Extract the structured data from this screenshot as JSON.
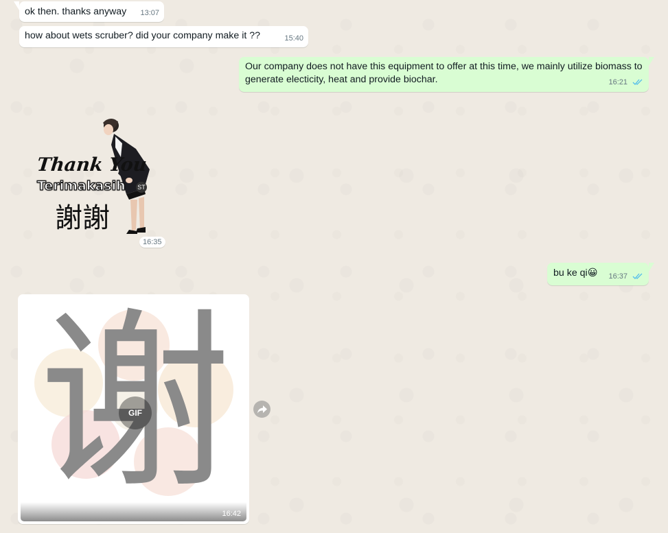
{
  "messages": [
    {
      "text": "ok then. thanks anyway",
      "time": "13:07"
    },
    {
      "text": "how about wets scruber? did your company make it ??",
      "time": "15:40"
    },
    {
      "text": "Our company does not have this equipment to offer at this time, we mainly utilize biomass to generate electicity, heat and provide biochar.",
      "time": "16:21"
    },
    {
      "text": "bu ke qi",
      "emoji": "😀",
      "time": "16:37"
    }
  ],
  "sticker": {
    "line1": "Thank You",
    "line2": "Terimakasih",
    "line3": "謝謝",
    "watermark": "ST",
    "time": "16:35"
  },
  "gif": {
    "character": "谢",
    "badge": "GIF",
    "time": "16:42"
  },
  "icons": {
    "read_receipt": "double-check-icon",
    "forward": "forward-icon"
  },
  "colors": {
    "chat_bg": "#efeae2",
    "incoming": "#ffffff",
    "outgoing": "#d9fdd3",
    "read_tick": "#53bdeb"
  }
}
